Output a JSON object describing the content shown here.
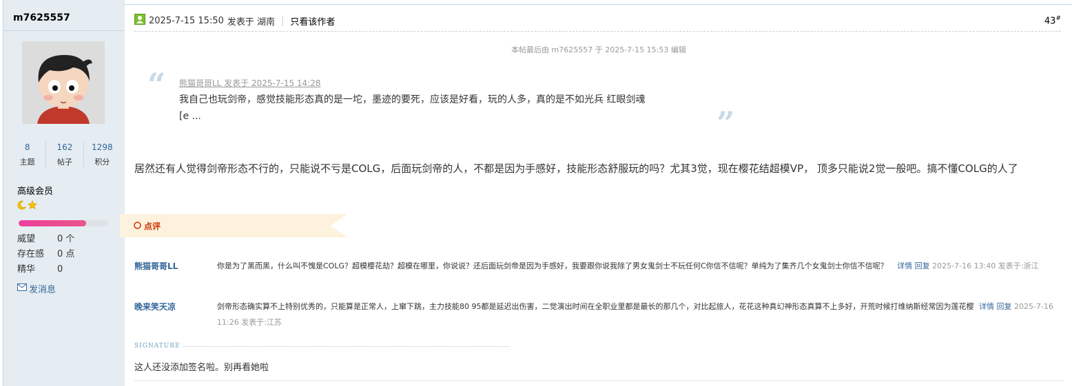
{
  "author": {
    "username": "m7625557",
    "stats": [
      {
        "value": "8",
        "label": "主题"
      },
      {
        "value": "162",
        "label": "帖子"
      },
      {
        "value": "1298",
        "label": "积分"
      }
    ],
    "usergroup": "高级会员",
    "rank_icons": [
      "moon-icon",
      "star-icon"
    ],
    "progress_fraction": 0.75,
    "info": [
      {
        "key": "威望",
        "value": "0 个"
      },
      {
        "key": "存在感",
        "value": "0 点"
      },
      {
        "key": "精华",
        "value": "0"
      }
    ],
    "pm_label": "发消息"
  },
  "post": {
    "timestamp": "2025-7-15 15:50",
    "posted_in": "发表于 湖南",
    "view_author_only": "只看该作者",
    "floor_number": "43",
    "floor_mark": "#",
    "last_edit": "本帖最后由 m7625557 于 2025-7-15 15:53 编辑",
    "quote": {
      "cite": "熊猫哥哥LL 发表于 2025-7-15 14:28",
      "line1": "我自己也玩剑帝，感觉技能形态真的是一坨，墨迹的要死，应该是好看，玩的人多，真的是不如光兵 红眼剑魂",
      "line2": "[e ..."
    },
    "body": "居然还有人觉得剑帝形态不行的，只能说不亏是COLG，后面玩剑帝的人，不都是因为手感好，技能形态舒服玩的吗？尤其3觉，现在樱花结超模VP， 顶多只能说2觉一般吧。搞不懂COLG的人了"
  },
  "review": {
    "label": "点评",
    "comments": [
      {
        "user": "熊猫哥哥LL",
        "text": "你是为了黑而黑，什么叫不愧是COLG？超模樱花劫？超模在哪里，你说说？还后面玩剑帝是因为手感好，我要跟你说我除了男女鬼剑士不玩任何C你信不信呢？单纯为了集齐几个女鬼剑士你信不信呢？",
        "details": "详情",
        "reply": "回复",
        "meta": "2025-7-16 13:40 发表于:浙江"
      },
      {
        "user": "晚来笑天凉",
        "text": "剑帝形态确实算不上特别优秀的，只能算是正常人，上窜下跳，主力技能80 95都是延迟出伤害，二觉演出时间在全职业里都是最长的那几个，对比起旅人，花花这种真幻神形态真算不上多好，开荒时候打维纳斯经常因为莲花樱",
        "details": "详情",
        "reply": "回复",
        "meta": "2025-7-16 11:26 发表于:江苏"
      }
    ]
  },
  "signature": {
    "label": "SIGNATURE",
    "text": "这人还没添加签名啦。别再看她啦"
  },
  "colors": {
    "link": "#336699",
    "sidebar_bg": "#e5edf2",
    "review_red": "#cc3300",
    "quote_mark": "#c8d8e6",
    "progress": "#ef3d9c"
  }
}
